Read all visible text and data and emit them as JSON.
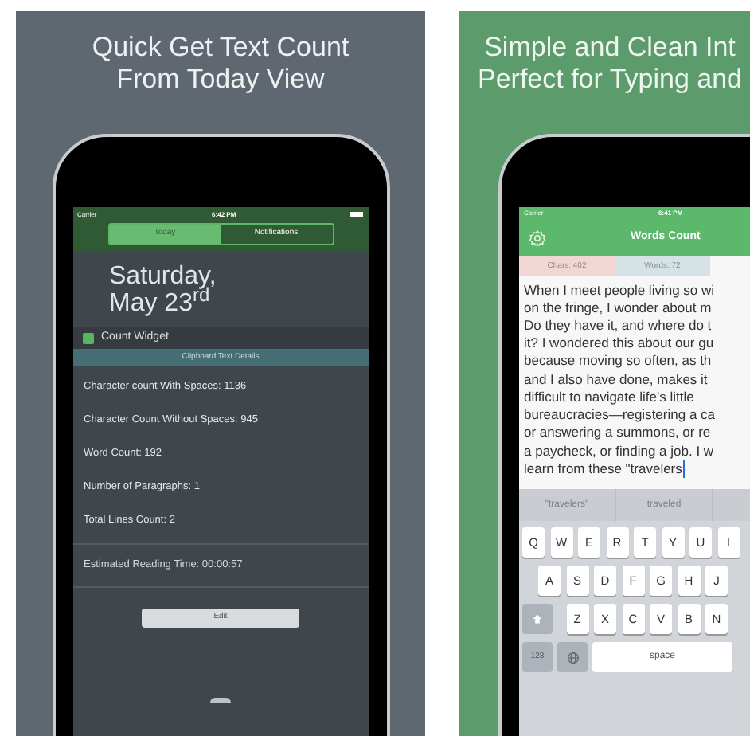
{
  "panels": [
    {
      "kind": "widget",
      "headline": [
        "Quick Get Text Count",
        "From Today View"
      ],
      "phone": {
        "status": {
          "carrier": "Carrier",
          "time": "6:42 PM"
        },
        "tabs": [
          {
            "label": "Today",
            "selected": true
          },
          {
            "label": "Notifications",
            "selected": false
          }
        ],
        "date": [
          "Saturday,",
          "May 23$^{rd}$"
        ],
        "widget_title": "Count Widget",
        "section_header": "Clipboard Text Details",
        "rows": [
          "Character count With Spaces: 1136",
          "Character Count Without Spaces: 945",
          "Word Count: 192",
          "Number of Paragraphs: 1",
          "Total Lines Count: 2"
        ],
        "reading_time": "Estimated Reading Time: 00:00:57",
        "button": "Edit"
      }
    },
    {
      "kind": "editor",
      "headline": [
        "Simple and Clean Int",
        "Perfect for Typing and"
      ],
      "phone": {
        "status": {
          "carrier": "Carrier",
          "time": "6:41 PM"
        },
        "title": "Words Count",
        "stats": [
          {
            "label": "Chars: 402",
            "color": "#f2d6d3"
          },
          {
            "label": "Words: 72",
            "color": "#d5e3e6"
          }
        ],
        "text_lines": [
          "When I meet people living so wi",
          "on the fringe, I wonder about m",
          "Do they have it, and where do t",
          "it? I wondered this about our gu",
          "because moving so often, as th",
          "and I also have done, makes it",
          "difficult to navigate life's little",
          "bureaucracies—registering a ca",
          "or answering a summons, or re",
          "a paycheck, or finding a job. I w",
          "learn from these \"travelers"
        ],
        "suggestions": [
          "\"travelers\"",
          "traveled"
        ],
        "keyboard_rows": [
          [
            "Q",
            "W",
            "E",
            "R",
            "T",
            "Y",
            "U",
            "I"
          ],
          [
            "A",
            "S",
            "D",
            "F",
            "G",
            "H",
            "J"
          ],
          [
            "Z",
            "X",
            "C",
            "V",
            "B",
            "N"
          ]
        ],
        "bottom_keys": [
          "123",
          "space"
        ]
      }
    }
  ]
}
